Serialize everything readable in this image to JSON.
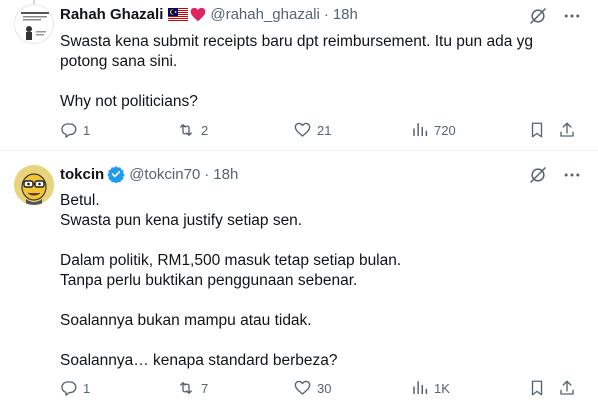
{
  "tweets": [
    {
      "name": "Rahah Ghazali",
      "handle": "@rahah_ghazali",
      "separator": "·",
      "time": "18h",
      "text": "Swasta kena submit receipts baru dpt reimbursement. Itu pun ada yg potong sana sini.\n\nWhy not politicians?",
      "replies": "1",
      "reposts": "2",
      "likes": "21",
      "views": "720",
      "icons": [
        "malaysia-flag-icon",
        "red-heart-icon",
        "grok-icon",
        "more-icon",
        "reply-icon",
        "repost-icon",
        "like-icon",
        "views-icon",
        "bookmark-icon",
        "share-icon"
      ]
    },
    {
      "name": "tokcin",
      "handle": "@tokcin70",
      "separator": "·",
      "time": "18h",
      "text": "Betul.\nSwasta pun kena justify setiap sen.\n\nDalam politik, RM1,500 masuk tetap setiap bulan.\nTanpa perlu buktikan penggunaan sebenar.\n\nSoalannya bukan mampu atau tidak.\n\nSoalannya… kenapa standard berbeza?",
      "replies": "1",
      "reposts": "7",
      "likes": "30",
      "views": "1K",
      "icons": [
        "verified-badge-icon",
        "grok-icon",
        "more-icon",
        "reply-icon",
        "repost-icon",
        "like-icon",
        "views-icon",
        "bookmark-icon",
        "share-icon"
      ]
    }
  ],
  "colors": {
    "text": "#0f1419",
    "secondary": "#536471",
    "verified": "#1d9bf0",
    "heart": "#f91880",
    "divider": "#eff3f4"
  }
}
